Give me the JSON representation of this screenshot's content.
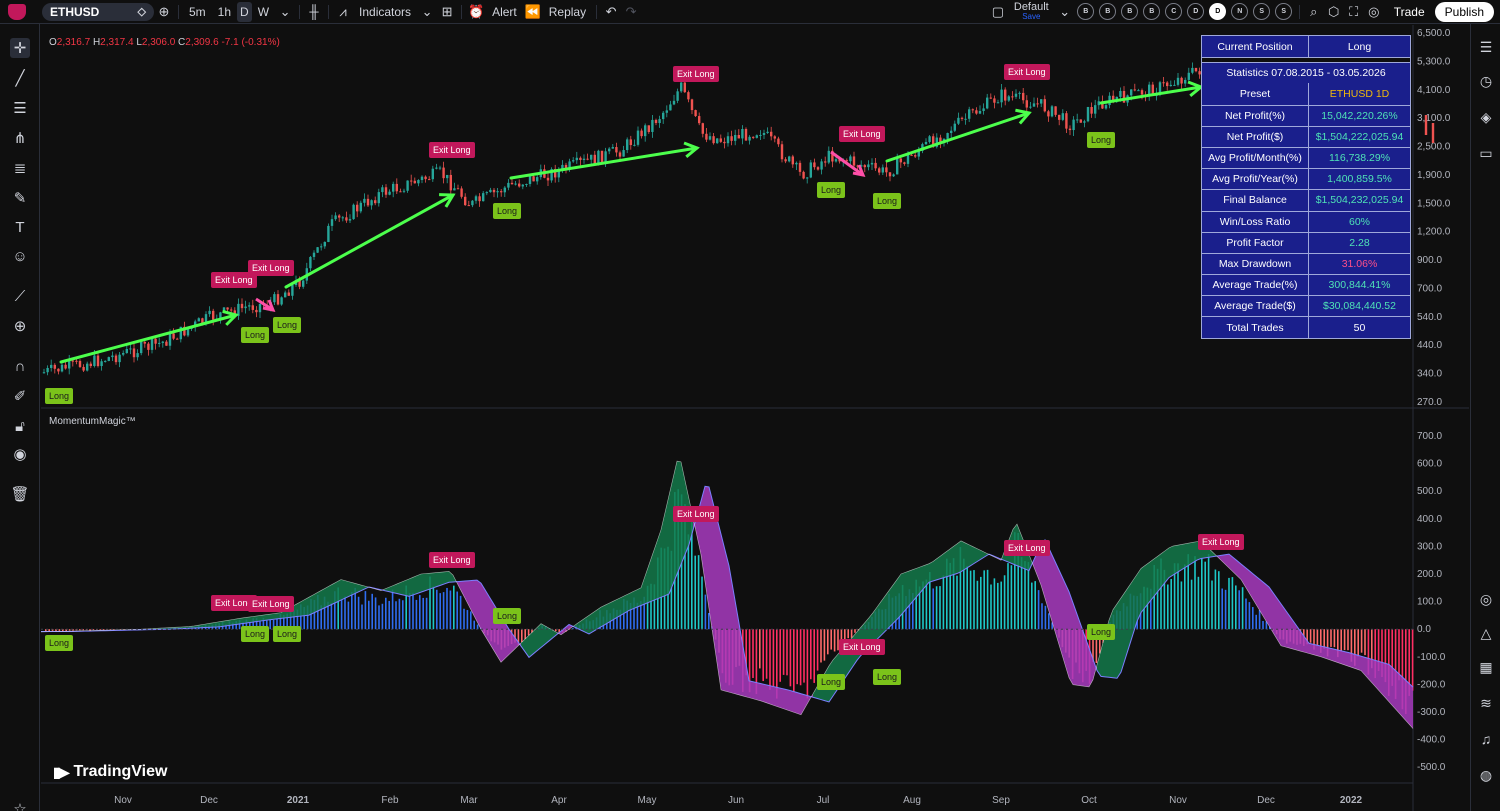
{
  "toolbar": {
    "symbol": "ETHUSD",
    "timeframes": [
      "5m",
      "1h",
      "D",
      "W"
    ],
    "active_timeframe": "D",
    "indicators_label": "Indicators",
    "alert_label": "Alert",
    "replay_label": "Replay",
    "layout_name": "Default",
    "layout_save": "Save",
    "circle_buttons": [
      "B",
      "B",
      "B",
      "B",
      "C",
      "D",
      "D",
      "N",
      "S",
      "S"
    ],
    "active_circle": 6,
    "trade_label": "Trade",
    "publish_label": "Publish"
  },
  "ohlc": {
    "o_label": "O",
    "o": "2,316.7",
    "h_label": "H",
    "h": "2,317.4",
    "l_label": "L",
    "l": "2,306.0",
    "c_label": "C",
    "c": "2,309.6",
    "change": "-7.1 (-0.31%)"
  },
  "indicator_name": "MomentumMagic™",
  "brand": "TradingView",
  "price_axis": [
    "6,500.0",
    "5,300.0",
    "4,100.0",
    "3,100.0",
    "2,500.0",
    "1,900.0",
    "1,500.0",
    "1,200.0",
    "900.0",
    "700.0",
    "540.0",
    "440.0",
    "340.0",
    "270.0"
  ],
  "osc_axis": [
    "700.0",
    "600.0",
    "500.0",
    "400.0",
    "300.0",
    "200.0",
    "100.0",
    "0.0",
    "-100.0",
    "-200.0",
    "-300.0",
    "-400.0",
    "-500.0"
  ],
  "time_axis": [
    "Nov",
    "Dec",
    "2021",
    "Feb",
    "Mar",
    "Apr",
    "May",
    "Jun",
    "Jul",
    "Aug",
    "Sep",
    "Oct",
    "Nov",
    "Dec",
    "2022"
  ],
  "signals": {
    "exit_label": "Exit Long",
    "long_label": "Long"
  },
  "stats": {
    "current_position_label": "Current Position",
    "current_position": "Long",
    "period": "Statistics 07.08.2015 - 03.05.2026",
    "rows": [
      {
        "label": "Preset",
        "value": "ETHUSD 1D"
      },
      {
        "label": "Net Profit(%)",
        "value": "15,042,220.26%"
      },
      {
        "label": "Net Profit($)",
        "value": "$1,504,222,025.94"
      },
      {
        "label": "Avg Profit/Month(%)",
        "value": "116,738.29%"
      },
      {
        "label": "Avg Profit/Year(%)",
        "value": "1,400,859.5%"
      },
      {
        "label": "Final Balance",
        "value": "$1,504,232,025.94"
      },
      {
        "label": "Win/Loss Ratio",
        "value": "60%"
      },
      {
        "label": "Profit Factor",
        "value": "2.28"
      },
      {
        "label": "Max Drawdown",
        "value": "31.06%"
      },
      {
        "label": "Average Trade(%)",
        "value": "300,844.41%"
      },
      {
        "label": "Average Trade($)",
        "value": "$30,084,440.52"
      },
      {
        "label": "Total Trades",
        "value": "50"
      }
    ]
  },
  "colors": {
    "background": "#0f0f0f",
    "up_candle": "#26a69a",
    "down_candle": "#ef5350",
    "exit_badge": "#c2185b",
    "long_badge": "#7bc31a",
    "trend_up": "#4cff4c",
    "trend_down": "#ff4fa8",
    "table_bg": "#1a1f8c"
  }
}
